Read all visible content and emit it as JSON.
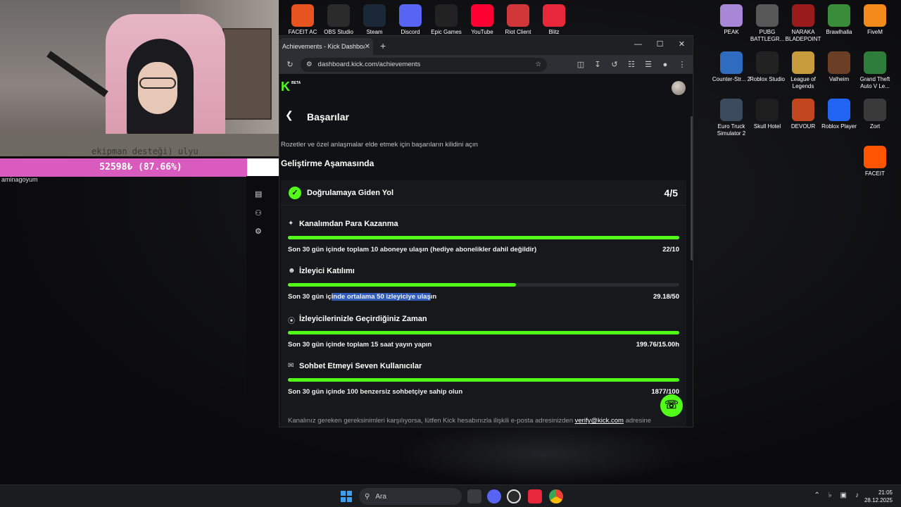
{
  "webcam": {
    "caption": "ekipman desteği) ulyu",
    "progress_text": "52598₺ (87.66%)",
    "progress_fraction": 0.8766,
    "alert_user": "aminagoyum"
  },
  "desktop_icons": {
    "top_row": [
      {
        "label": "FACEIT AC",
        "icon": "faceit-ac-icon",
        "color": "#e8541f"
      },
      {
        "label": "OBS Studio",
        "icon": "obs-icon",
        "color": "#2b2b2b"
      },
      {
        "label": "Steam",
        "icon": "steam-icon",
        "color": "#1b2838"
      },
      {
        "label": "Discord",
        "icon": "discord-icon",
        "color": "#5865f2"
      },
      {
        "label": "Epic Games",
        "icon": "epic-games-icon",
        "color": "#222222"
      },
      {
        "label": "YouTube",
        "icon": "youtube-icon",
        "color": "#ff0033"
      },
      {
        "label": "Riot Client",
        "icon": "riot-icon",
        "color": "#d13639"
      },
      {
        "label": "Blitz",
        "icon": "blitz-icon",
        "color": "#e8283a"
      }
    ],
    "right_grid": [
      {
        "label": "PEAK",
        "icon": "peak-icon",
        "color": "#a887d6"
      },
      {
        "label": "PUBG BATTLEGR...",
        "icon": "pubg-icon",
        "color": "#575757"
      },
      {
        "label": "NARAKA BLADEPOINT",
        "icon": "naraka-icon",
        "color": "#9a1b1b"
      },
      {
        "label": "Brawlhalla",
        "icon": "brawlhalla-icon",
        "color": "#3a8b3a"
      },
      {
        "label": "FiveM",
        "icon": "fivem-icon",
        "color": "#f28a1c"
      },
      {
        "label": "Counter-Str... 2",
        "icon": "cs2-icon",
        "color": "#2f6cc0"
      },
      {
        "label": "Roblox Studio",
        "icon": "roblox-studio-icon",
        "color": "#222222"
      },
      {
        "label": "League of Legends",
        "icon": "lol-icon",
        "color": "#c89b3c"
      },
      {
        "label": "Valheim",
        "icon": "valheim-icon",
        "color": "#6b3f25"
      },
      {
        "label": "Grand Theft Auto V Le...",
        "icon": "gta-icon",
        "color": "#2f7d3a"
      },
      {
        "label": "Euro Truck Simulator 2",
        "icon": "ets2-icon",
        "color": "#3b4a5c"
      },
      {
        "label": "Skull Hotel",
        "icon": "skull-hotel-icon",
        "color": "#1e1e1e"
      },
      {
        "label": "DEVOUR",
        "icon": "devour-icon",
        "color": "#c1461f"
      },
      {
        "label": "Roblox Player",
        "icon": "roblox-icon",
        "color": "#2265f2"
      },
      {
        "label": "Zort",
        "icon": "zort-icon",
        "color": "#3a3a3a"
      },
      {
        "label": "FACEIT",
        "icon": "faceit-icon",
        "color": "#ff5500"
      }
    ]
  },
  "browser": {
    "tab_title": "Achievements - Kick Dashboard",
    "url": "dashboard.kick.com/achievements"
  },
  "page": {
    "logo": "K",
    "beta": "BETA",
    "title": "Başarılar",
    "subtitle": "Rozetler ve özel anlaşmalar elde etmek için başarıların kilidini açın",
    "section": "Geliştirme Aşamasında",
    "card": {
      "title": "Doğrulamaya Giden Yol",
      "count": "4/5",
      "achievements": [
        {
          "title": "Kanalımdan Para Kazanma",
          "icon": "sparkle-icon",
          "desc": "Son 30 gün içinde toplam 10 aboneye ulaşın (hediye abonelikler dahil değildir)",
          "value": "22/10",
          "progress": 1.0
        },
        {
          "title": "İzleyici Katılımı",
          "icon": "users-icon",
          "desc_pre": "Son 30 gün iç",
          "desc_hl": "inde ortalama 50 izleyiciye ulaş",
          "desc_post": "ın",
          "value": "29.18/50",
          "progress": 0.5836
        },
        {
          "title": "İzleyicilerinizle Geçirdiğiniz Zaman",
          "icon": "broadcast-icon",
          "desc": "Son 30 gün içinde toplam 15 saat yayın yapın",
          "value": "199.76/15.00h",
          "progress": 1.0
        },
        {
          "title": "Sohbet Etmeyi Seven Kullanıcılar",
          "icon": "chat-icon",
          "desc": "Son 30 gün içinde 100 benzersiz sohbetçiye sahip olun",
          "value": "1877/100",
          "progress": 1.0
        }
      ]
    },
    "footer_pre": "Kanalınız gereken gereksinimleri karşılıyorsa, lütfen Kick hesabınızla ilişkili e-posta adresinizden",
    "footer_mail": "verify@kick.com",
    "footer_post": "adresine"
  },
  "taskbar": {
    "search_placeholder": "Ara",
    "time": "21:05",
    "date": "28.12.2025"
  },
  "colors": {
    "kick_green": "#53fc18",
    "donation_pink": "#d85bbd"
  }
}
